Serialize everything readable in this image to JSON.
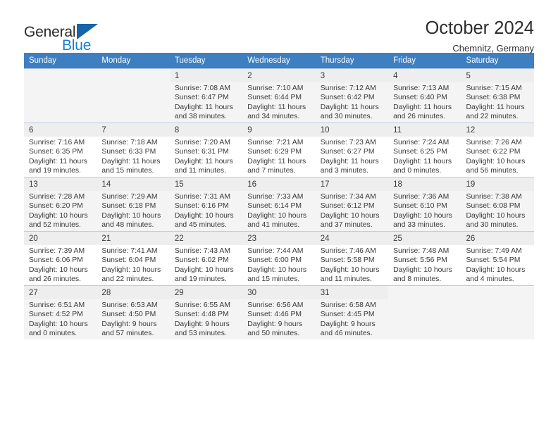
{
  "brand": {
    "line1": "General",
    "line2": "Blue",
    "flag_icon": "triangle-flag-icon",
    "accent_color": "#1a7fd4"
  },
  "header": {
    "title": "October 2024",
    "subtitle": "Chemnitz, Germany"
  },
  "calendar": {
    "header_bg": "#3d7fc1",
    "weekday_headers": [
      "Sunday",
      "Monday",
      "Tuesday",
      "Wednesday",
      "Thursday",
      "Friday",
      "Saturday"
    ],
    "weeks": [
      [
        {
          "day": "",
          "sunrise": "",
          "sunset": "",
          "daylight": ""
        },
        {
          "day": "",
          "sunrise": "",
          "sunset": "",
          "daylight": ""
        },
        {
          "day": "1",
          "sunrise": "Sunrise: 7:08 AM",
          "sunset": "Sunset: 6:47 PM",
          "daylight": "Daylight: 11 hours and 38 minutes."
        },
        {
          "day": "2",
          "sunrise": "Sunrise: 7:10 AM",
          "sunset": "Sunset: 6:44 PM",
          "daylight": "Daylight: 11 hours and 34 minutes."
        },
        {
          "day": "3",
          "sunrise": "Sunrise: 7:12 AM",
          "sunset": "Sunset: 6:42 PM",
          "daylight": "Daylight: 11 hours and 30 minutes."
        },
        {
          "day": "4",
          "sunrise": "Sunrise: 7:13 AM",
          "sunset": "Sunset: 6:40 PM",
          "daylight": "Daylight: 11 hours and 26 minutes."
        },
        {
          "day": "5",
          "sunrise": "Sunrise: 7:15 AM",
          "sunset": "Sunset: 6:38 PM",
          "daylight": "Daylight: 11 hours and 22 minutes."
        }
      ],
      [
        {
          "day": "6",
          "sunrise": "Sunrise: 7:16 AM",
          "sunset": "Sunset: 6:35 PM",
          "daylight": "Daylight: 11 hours and 19 minutes."
        },
        {
          "day": "7",
          "sunrise": "Sunrise: 7:18 AM",
          "sunset": "Sunset: 6:33 PM",
          "daylight": "Daylight: 11 hours and 15 minutes."
        },
        {
          "day": "8",
          "sunrise": "Sunrise: 7:20 AM",
          "sunset": "Sunset: 6:31 PM",
          "daylight": "Daylight: 11 hours and 11 minutes."
        },
        {
          "day": "9",
          "sunrise": "Sunrise: 7:21 AM",
          "sunset": "Sunset: 6:29 PM",
          "daylight": "Daylight: 11 hours and 7 minutes."
        },
        {
          "day": "10",
          "sunrise": "Sunrise: 7:23 AM",
          "sunset": "Sunset: 6:27 PM",
          "daylight": "Daylight: 11 hours and 3 minutes."
        },
        {
          "day": "11",
          "sunrise": "Sunrise: 7:24 AM",
          "sunset": "Sunset: 6:25 PM",
          "daylight": "Daylight: 11 hours and 0 minutes."
        },
        {
          "day": "12",
          "sunrise": "Sunrise: 7:26 AM",
          "sunset": "Sunset: 6:22 PM",
          "daylight": "Daylight: 10 hours and 56 minutes."
        }
      ],
      [
        {
          "day": "13",
          "sunrise": "Sunrise: 7:28 AM",
          "sunset": "Sunset: 6:20 PM",
          "daylight": "Daylight: 10 hours and 52 minutes."
        },
        {
          "day": "14",
          "sunrise": "Sunrise: 7:29 AM",
          "sunset": "Sunset: 6:18 PM",
          "daylight": "Daylight: 10 hours and 48 minutes."
        },
        {
          "day": "15",
          "sunrise": "Sunrise: 7:31 AM",
          "sunset": "Sunset: 6:16 PM",
          "daylight": "Daylight: 10 hours and 45 minutes."
        },
        {
          "day": "16",
          "sunrise": "Sunrise: 7:33 AM",
          "sunset": "Sunset: 6:14 PM",
          "daylight": "Daylight: 10 hours and 41 minutes."
        },
        {
          "day": "17",
          "sunrise": "Sunrise: 7:34 AM",
          "sunset": "Sunset: 6:12 PM",
          "daylight": "Daylight: 10 hours and 37 minutes."
        },
        {
          "day": "18",
          "sunrise": "Sunrise: 7:36 AM",
          "sunset": "Sunset: 6:10 PM",
          "daylight": "Daylight: 10 hours and 33 minutes."
        },
        {
          "day": "19",
          "sunrise": "Sunrise: 7:38 AM",
          "sunset": "Sunset: 6:08 PM",
          "daylight": "Daylight: 10 hours and 30 minutes."
        }
      ],
      [
        {
          "day": "20",
          "sunrise": "Sunrise: 7:39 AM",
          "sunset": "Sunset: 6:06 PM",
          "daylight": "Daylight: 10 hours and 26 minutes."
        },
        {
          "day": "21",
          "sunrise": "Sunrise: 7:41 AM",
          "sunset": "Sunset: 6:04 PM",
          "daylight": "Daylight: 10 hours and 22 minutes."
        },
        {
          "day": "22",
          "sunrise": "Sunrise: 7:43 AM",
          "sunset": "Sunset: 6:02 PM",
          "daylight": "Daylight: 10 hours and 19 minutes."
        },
        {
          "day": "23",
          "sunrise": "Sunrise: 7:44 AM",
          "sunset": "Sunset: 6:00 PM",
          "daylight": "Daylight: 10 hours and 15 minutes."
        },
        {
          "day": "24",
          "sunrise": "Sunrise: 7:46 AM",
          "sunset": "Sunset: 5:58 PM",
          "daylight": "Daylight: 10 hours and 11 minutes."
        },
        {
          "day": "25",
          "sunrise": "Sunrise: 7:48 AM",
          "sunset": "Sunset: 5:56 PM",
          "daylight": "Daylight: 10 hours and 8 minutes."
        },
        {
          "day": "26",
          "sunrise": "Sunrise: 7:49 AM",
          "sunset": "Sunset: 5:54 PM",
          "daylight": "Daylight: 10 hours and 4 minutes."
        }
      ],
      [
        {
          "day": "27",
          "sunrise": "Sunrise: 6:51 AM",
          "sunset": "Sunset: 4:52 PM",
          "daylight": "Daylight: 10 hours and 0 minutes."
        },
        {
          "day": "28",
          "sunrise": "Sunrise: 6:53 AM",
          "sunset": "Sunset: 4:50 PM",
          "daylight": "Daylight: 9 hours and 57 minutes."
        },
        {
          "day": "29",
          "sunrise": "Sunrise: 6:55 AM",
          "sunset": "Sunset: 4:48 PM",
          "daylight": "Daylight: 9 hours and 53 minutes."
        },
        {
          "day": "30",
          "sunrise": "Sunrise: 6:56 AM",
          "sunset": "Sunset: 4:46 PM",
          "daylight": "Daylight: 9 hours and 50 minutes."
        },
        {
          "day": "31",
          "sunrise": "Sunrise: 6:58 AM",
          "sunset": "Sunset: 4:45 PM",
          "daylight": "Daylight: 9 hours and 46 minutes."
        },
        {
          "day": "",
          "sunrise": "",
          "sunset": "",
          "daylight": ""
        },
        {
          "day": "",
          "sunrise": "",
          "sunset": "",
          "daylight": ""
        }
      ]
    ]
  }
}
